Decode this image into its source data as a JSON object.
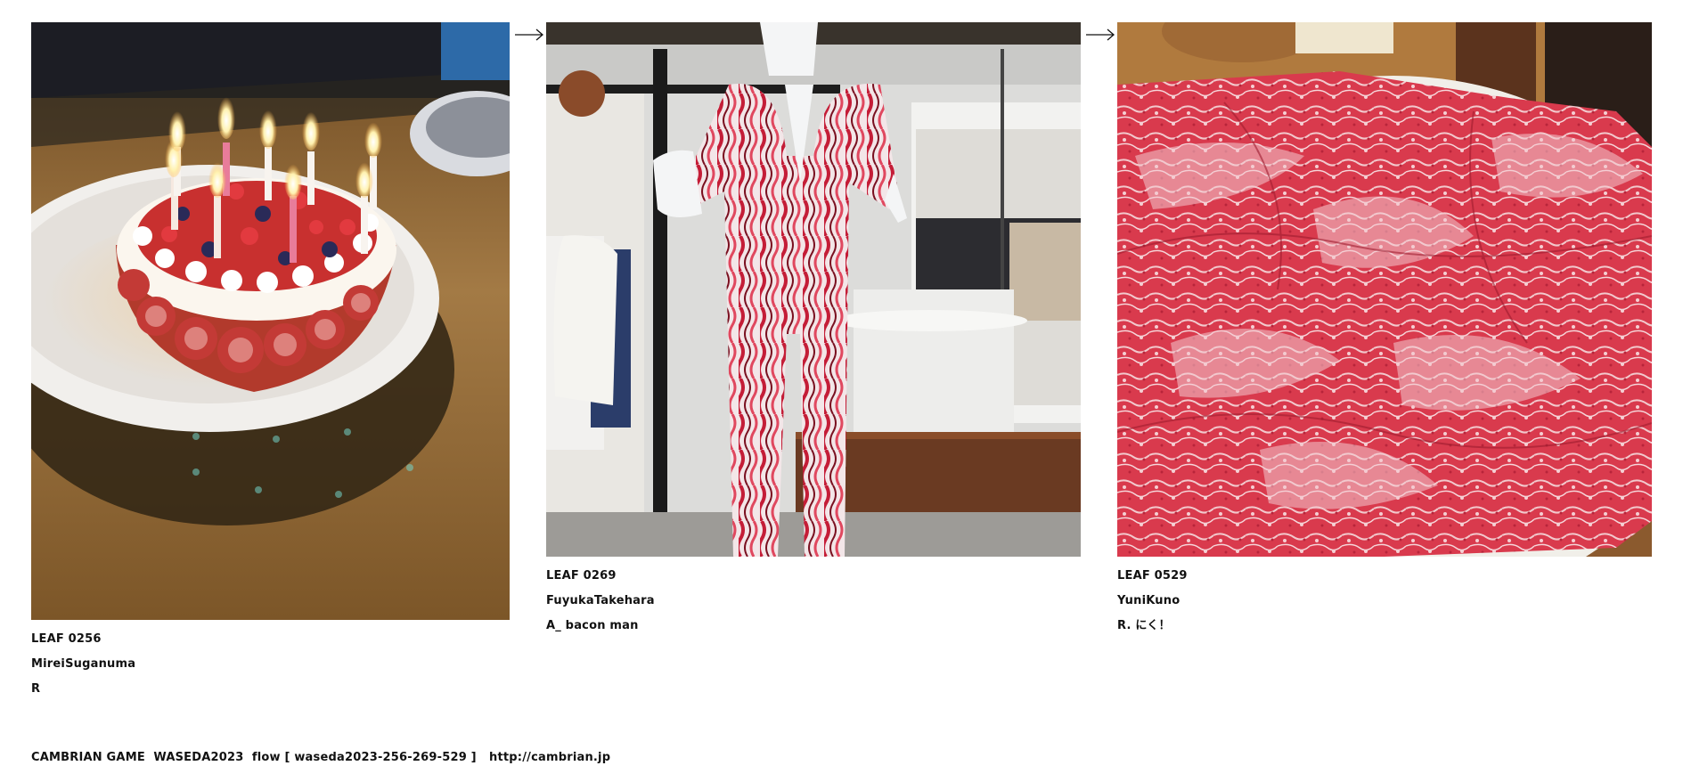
{
  "leaves": [
    {
      "number": "LEAF 0256",
      "author": "MireiSuganuma",
      "title": "R",
      "image": "birthday-cake-with-candles-photo"
    },
    {
      "number": "LEAF 0269",
      "author": "FuyukaTakehara",
      "title": "A_ bacon man",
      "image": "striped-jumpsuit-mannequin-photo"
    },
    {
      "number": "LEAF 0529",
      "author": "YuniKuno",
      "title": "R. にく！",
      "image": "marbled-beef-slices-photo"
    }
  ],
  "arrows": [
    "arrow-right-icon",
    "arrow-right-icon"
  ],
  "footer": {
    "credit": "CAMBRIAN GAME  WASEDA2023  flow [ waseda2023-256-269-529 ]",
    "link": "http://cambrian.jp"
  },
  "colors": {
    "background": "#ffffff",
    "text": "#111111"
  }
}
